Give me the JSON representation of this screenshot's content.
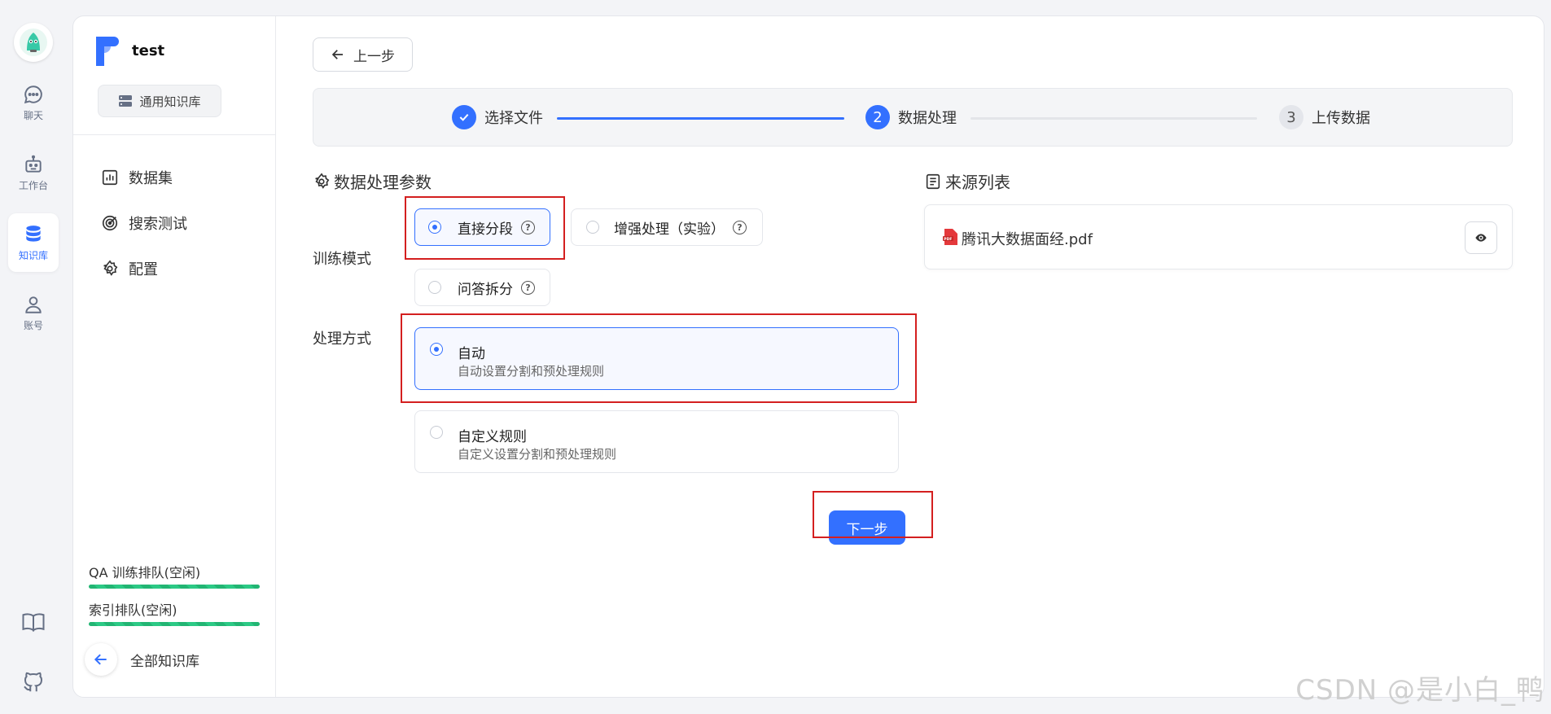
{
  "rail": {
    "items": [
      {
        "label": "聊天",
        "icon": "chat-icon"
      },
      {
        "label": "工作台",
        "icon": "robot-icon"
      },
      {
        "label": "知识库",
        "icon": "database-icon"
      },
      {
        "label": "账号",
        "icon": "user-icon"
      }
    ],
    "active": "知识库",
    "bottom": [
      "book-icon",
      "github-icon"
    ]
  },
  "sidebar": {
    "kb_name": "test",
    "kb_type": "通用知识库",
    "nav": [
      {
        "label": "数据集",
        "icon": "chart-icon"
      },
      {
        "label": "搜索测试",
        "icon": "target-icon"
      },
      {
        "label": "配置",
        "icon": "gear-icon"
      }
    ],
    "queues": [
      {
        "label": "QA 训练排队(空闲)",
        "progress": 1.0
      },
      {
        "label": "索引排队(空闲)",
        "progress": 1.0
      }
    ],
    "back_label": "全部知识库"
  },
  "toolbar": {
    "prev_label": "上一步"
  },
  "steps": [
    {
      "label": "选择文件",
      "index": "1",
      "state": "done"
    },
    {
      "label": "数据处理",
      "index": "2",
      "state": "current"
    },
    {
      "label": "上传数据",
      "index": "3",
      "state": "todo"
    }
  ],
  "params": {
    "title": "数据处理参数",
    "train_mode_label": "训练模式",
    "train_modes": [
      {
        "label": "直接分段",
        "selected": true
      },
      {
        "label": "增强处理（实验）",
        "selected": false
      },
      {
        "label": "问答拆分",
        "selected": false
      }
    ],
    "process_label": "处理方式",
    "process_modes": [
      {
        "title": "自动",
        "desc": "自动设置分割和预处理规则",
        "selected": true
      },
      {
        "title": "自定义规则",
        "desc": "自定义设置分割和预处理规则",
        "selected": false
      }
    ],
    "next_label": "下一步"
  },
  "sources": {
    "title": "来源列表",
    "files": [
      {
        "name": "腾讯大数据面经.pdf",
        "icon": "pdf-icon"
      }
    ]
  },
  "watermark": "CSDN @是小白_鸭",
  "colors": {
    "accent": "#3370ff",
    "highlight": "#d41f1f",
    "queue_bar": "#22b573"
  }
}
